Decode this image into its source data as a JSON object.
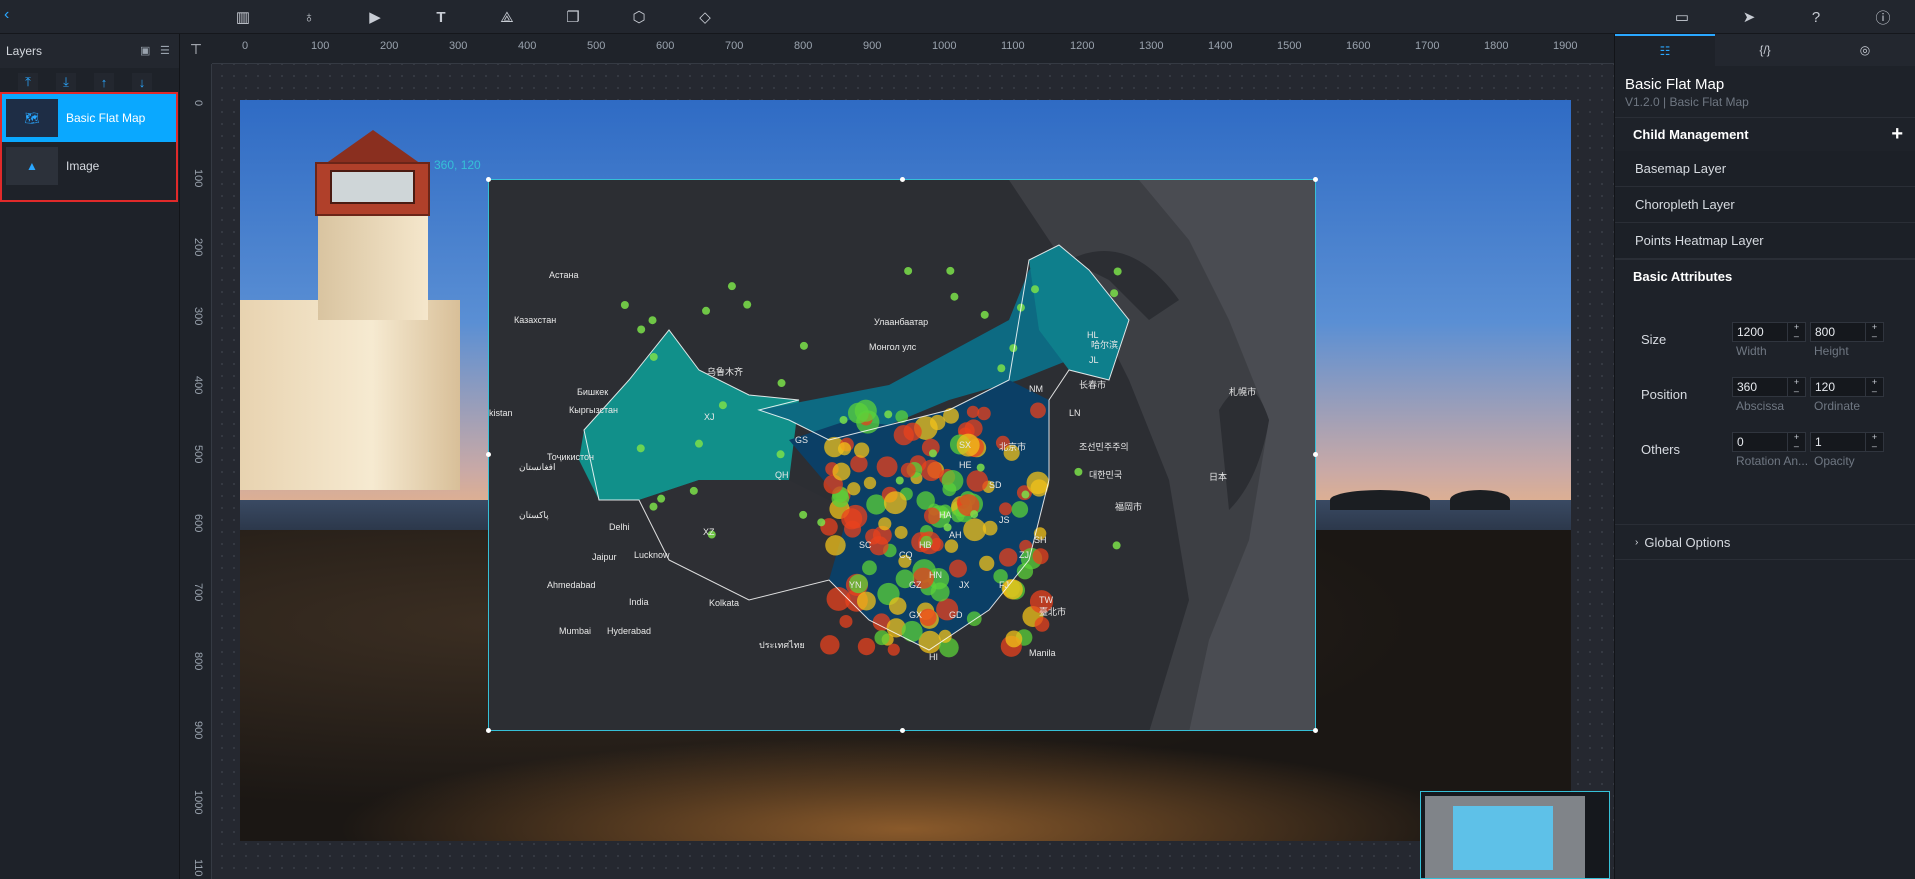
{
  "toolbar": {
    "back": "‹",
    "icons": [
      "chart-icon",
      "map-pin-icon",
      "media-icon",
      "text-icon",
      "network-icon",
      "layers-stack-icon",
      "cube-icon",
      "gem-icon"
    ],
    "right_icons": [
      "preview-icon",
      "publish-icon",
      "help-icon",
      "info-icon"
    ]
  },
  "layers_panel": {
    "title": "Layers",
    "items": [
      {
        "label": "Basic Flat Map",
        "selected": true
      },
      {
        "label": "Image",
        "selected": false
      }
    ]
  },
  "ruler": {
    "h": [
      "0",
      "100",
      "200",
      "300",
      "400",
      "500",
      "600",
      "700",
      "800",
      "900",
      "1000",
      "1100",
      "1200",
      "1300",
      "1400",
      "1500",
      "1600",
      "1700",
      "1800",
      "1900"
    ],
    "v": [
      "0",
      "100",
      "200",
      "300",
      "400",
      "500",
      "600",
      "700",
      "800",
      "900",
      "1000",
      "110"
    ]
  },
  "canvas": {
    "coord_label": "360, 120",
    "map_labels": [
      "Астана",
      "Казахстан",
      "Улаанбаатар",
      "Монгол улс",
      "Бишкек",
      "Кыргызстан",
      "Тоҷикистон",
      "kistan",
      "افغانستان",
      "پاکستان",
      "Delhi",
      "Jaipur",
      "Lucknow",
      "Ahmedabad",
      "India",
      "Kolkata",
      "Mumbai",
      "Hyderabad",
      "ประเทศไทย",
      "Manila",
      "札幌市",
      "日本",
      "대한민국",
      "福岡市",
      "NM",
      "GS",
      "QH",
      "XZ",
      "XJ",
      "乌鲁木齐",
      "HL",
      "JL",
      "LN",
      "SX",
      "HE",
      "SD",
      "HA",
      "JS",
      "AH",
      "HB",
      "SC",
      "CQ",
      "GZ",
      "YN",
      "GX",
      "GD",
      "FJ",
      "JX",
      "HN",
      "ZJ",
      "SH",
      "TW",
      "HI",
      "臺北市",
      "北京市",
      "조선민주주의",
      "哈尔滨",
      "长春市"
    ]
  },
  "properties": {
    "tabs": [
      "settings-icon",
      "code-icon",
      "interaction-icon"
    ],
    "title": "Basic Flat Map",
    "subtitle": "V1.2.0 | Basic Flat Map",
    "child_management": "Child Management",
    "children": [
      "Basemap Layer",
      "Choropleth Layer",
      "Points Heatmap Layer"
    ],
    "basic_attributes": "Basic Attributes",
    "size": {
      "label": "Size",
      "width": "1200",
      "width_label": "Width",
      "height": "800",
      "height_label": "Height"
    },
    "position": {
      "label": "Position",
      "x": "360",
      "x_label": "Abscissa",
      "y": "120",
      "y_label": "Ordinate"
    },
    "others": {
      "label": "Others",
      "rotation": "0",
      "rotation_label": "Rotation An...",
      "opacity": "1",
      "opacity_label": "Opacity"
    },
    "global_options": "Global Options"
  }
}
